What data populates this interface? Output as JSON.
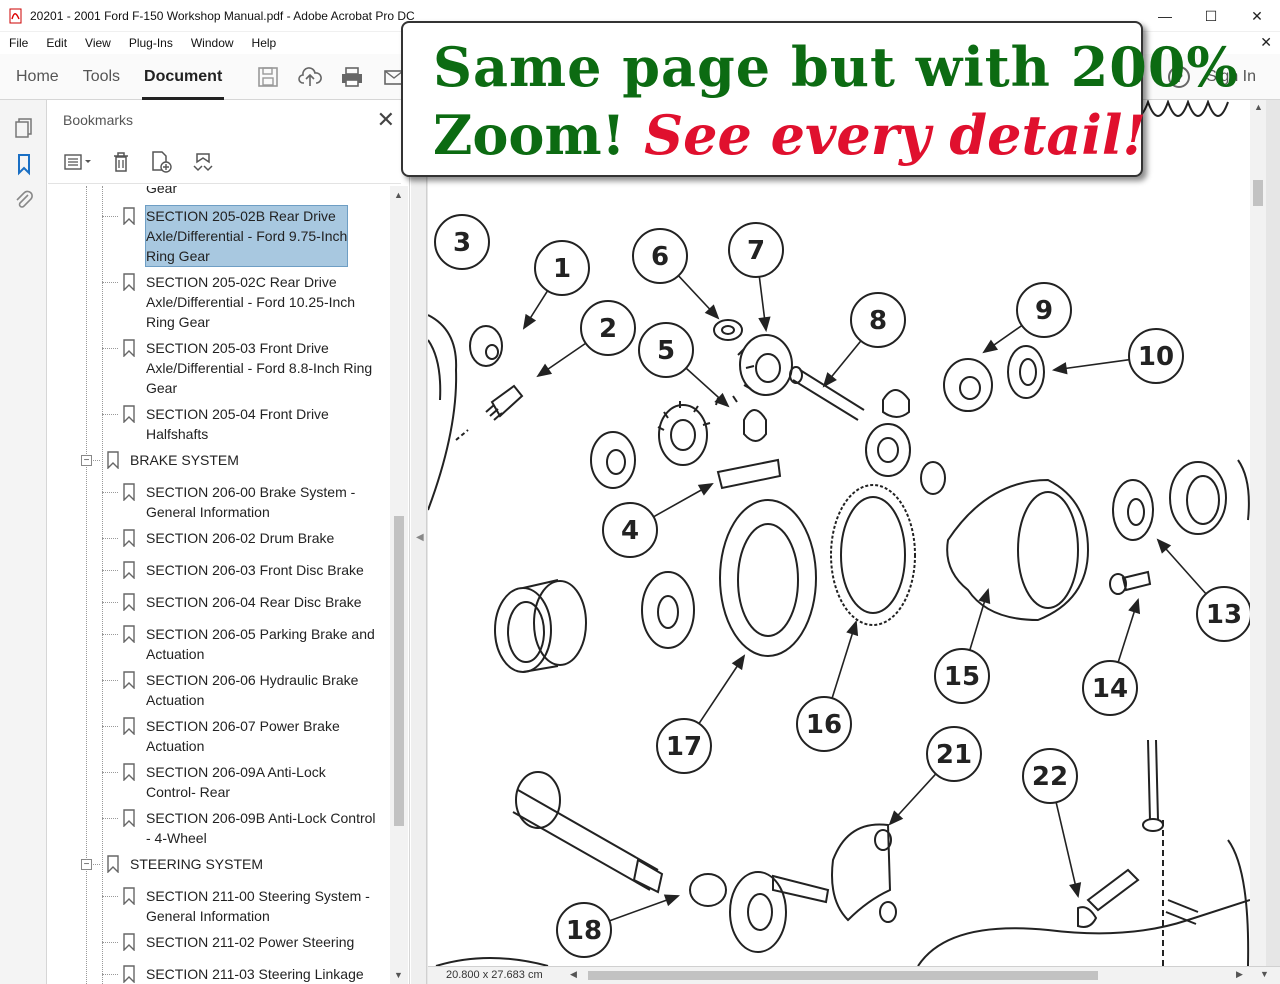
{
  "window": {
    "title": "20201 - 2001 Ford F-150 Workshop Manual.pdf - Adobe Acrobat Pro DC",
    "minimize": "—",
    "maximize": "☐",
    "close": "✕"
  },
  "menu": {
    "items": [
      "File",
      "Edit",
      "View",
      "Plug-Ins",
      "Window",
      "Help"
    ],
    "close_doc": "✕"
  },
  "toolbar": {
    "tabs": [
      "Home",
      "Tools",
      "Document"
    ],
    "active_tab": "Document",
    "help": "?",
    "sign_in": "Sign In"
  },
  "bookmarks": {
    "title": "Bookmarks",
    "close": "✕",
    "partial_top": "Gear",
    "items": [
      {
        "label": "SECTION 205-02B Rear Drive Axle/Differential - Ford 9.75-Inch Ring Gear",
        "lines": [
          "SECTION 205-02B Rear Drive",
          "Axle/Differential - Ford 9.75-Inch",
          "Ring Gear"
        ],
        "selected": true
      },
      {
        "label": "SECTION 205-02C Rear Drive Axle/Differential - Ford 10.25-Inch Ring Gear",
        "lines": [
          "SECTION 205-02C Rear Drive",
          "Axle/Differential - Ford 10.25-Inch",
          "Ring Gear"
        ]
      },
      {
        "label": "SECTION 205-03 Front Drive Axle/Differential - Ford 8.8-Inch Ring Gear",
        "lines": [
          "SECTION 205-03 Front Drive",
          "Axle/Differential - Ford 8.8-Inch Ring",
          "Gear"
        ]
      },
      {
        "label": "SECTION 205-04 Front Drive Halfshafts",
        "lines": [
          "SECTION 205-04 Front Drive",
          "Halfshafts"
        ]
      },
      {
        "label": "BRAKE SYSTEM",
        "lines": [
          "BRAKE SYSTEM"
        ],
        "group": true
      },
      {
        "label": "SECTION 206-00 Brake System - General Information",
        "lines": [
          "SECTION 206-00 Brake System -",
          "General Information"
        ]
      },
      {
        "label": "SECTION 206-02 Drum Brake",
        "lines": [
          "SECTION 206-02 Drum Brake"
        ]
      },
      {
        "label": "SECTION 206-03 Front Disc Brake",
        "lines": [
          "SECTION 206-03 Front Disc Brake"
        ]
      },
      {
        "label": "SECTION 206-04 Rear Disc Brake",
        "lines": [
          "SECTION 206-04 Rear Disc Brake"
        ]
      },
      {
        "label": "SECTION 206-05 Parking Brake and Actuation",
        "lines": [
          "SECTION 206-05 Parking Brake and",
          "Actuation"
        ]
      },
      {
        "label": "SECTION 206-06 Hydraulic Brake Actuation",
        "lines": [
          "SECTION 206-06 Hydraulic Brake",
          "Actuation"
        ]
      },
      {
        "label": "SECTION 206-07 Power Brake Actuation",
        "lines": [
          "SECTION 206-07 Power Brake",
          "Actuation"
        ]
      },
      {
        "label": "SECTION 206-09A Anti-Lock Control- Rear",
        "lines": [
          "SECTION 206-09A Anti-Lock",
          "Control- Rear"
        ]
      },
      {
        "label": "SECTION 206-09B Anti-Lock Control - 4-Wheel",
        "lines": [
          "SECTION 206-09B Anti-Lock Control",
          "- 4-Wheel"
        ]
      },
      {
        "label": "STEERING SYSTEM",
        "lines": [
          "STEERING SYSTEM"
        ],
        "group": true
      },
      {
        "label": "SECTION 211-00 Steering System - General Information",
        "lines": [
          "SECTION 211-00 Steering System -",
          "General Information"
        ]
      },
      {
        "label": "SECTION 211-02 Power Steering",
        "lines": [
          "SECTION 211-02 Power Steering"
        ]
      },
      {
        "label": "SECTION 211-03 Steering Linkage",
        "lines": [
          "SECTION 211-03 Steering Linkage"
        ]
      }
    ]
  },
  "callout": {
    "line1": "Same page but with 200%",
    "line2_plain": "Zoom! ",
    "line2_accent": "See every detail!"
  },
  "diagram": {
    "labels": [
      "1",
      "2",
      "3",
      "4",
      "5",
      "6",
      "7",
      "8",
      "9",
      "10",
      "13",
      "14",
      "15",
      "16",
      "17",
      "18",
      "21",
      "22"
    ]
  },
  "status": {
    "page_size": "20.800 x 27.683 cm"
  },
  "colors": {
    "callout_green": "#0c6b12",
    "callout_red": "#e0102e",
    "selection": "#a8c8e0"
  }
}
